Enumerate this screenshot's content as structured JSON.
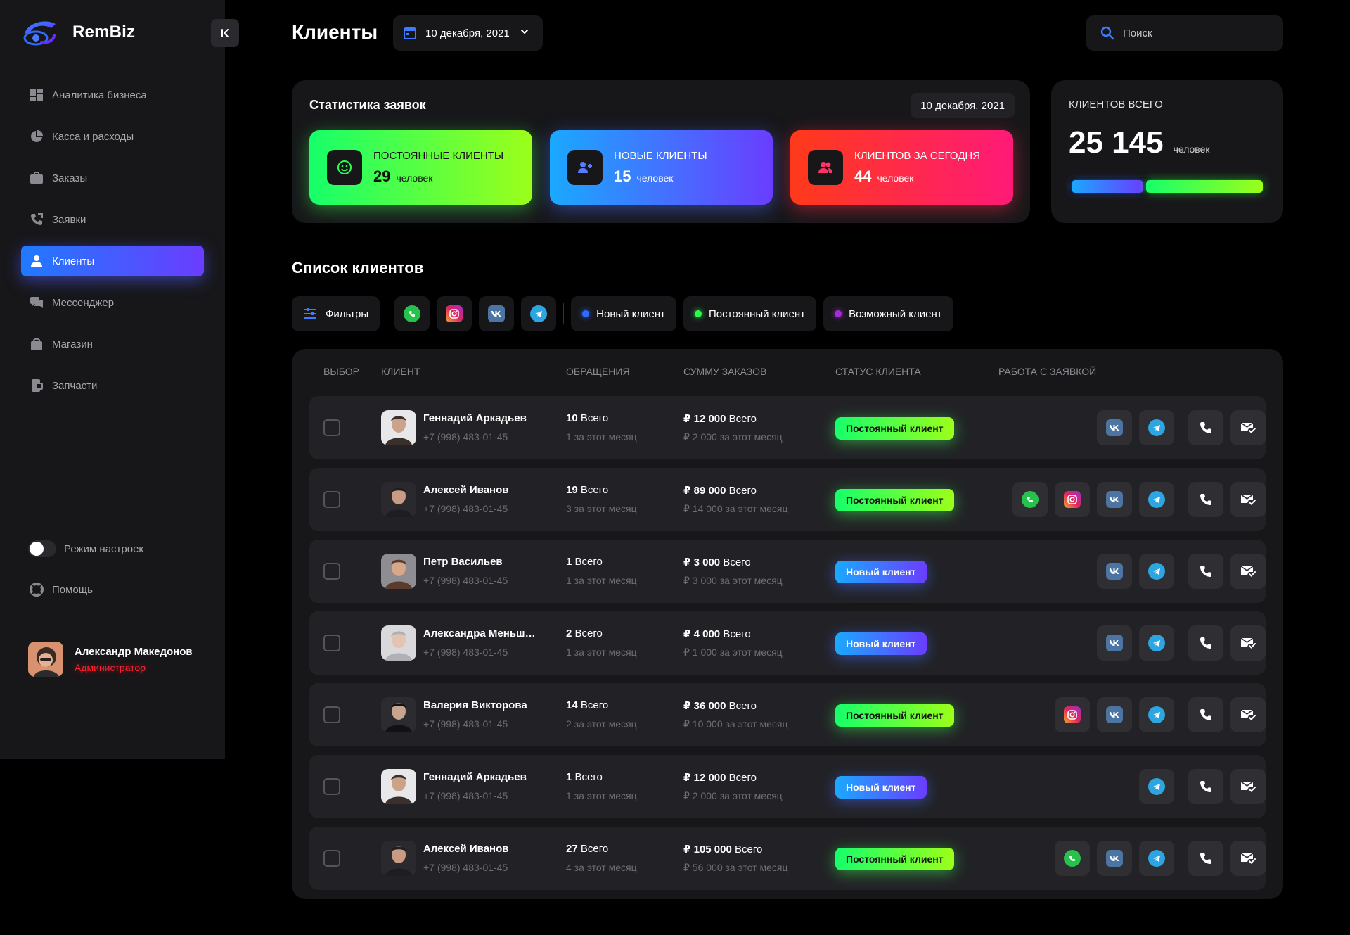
{
  "app": {
    "name": "RemBiz"
  },
  "sidebar": {
    "items": [
      {
        "label": "Аналитика бизнеса",
        "icon": "dashboard-icon"
      },
      {
        "label": "Касса и расходы",
        "icon": "pie-chart-icon"
      },
      {
        "label": "Заказы",
        "icon": "briefcase-icon"
      },
      {
        "label": "Заявки",
        "icon": "phone-call-icon"
      },
      {
        "label": "Клиенты",
        "icon": "user-icon",
        "active": true
      },
      {
        "label": "Мессенджер",
        "icon": "chat-icon"
      },
      {
        "label": "Магазин",
        "icon": "shopping-bag-icon"
      },
      {
        "label": "Запчасти",
        "icon": "parts-icon"
      }
    ],
    "settings_label": "Режим настроек",
    "help_label": "Помощь",
    "user": {
      "name": "Александр Македонов",
      "role": "Администратор"
    }
  },
  "header": {
    "title": "Клиенты",
    "date": "10 декабря, 2021",
    "search_placeholder": "Поиск"
  },
  "stats": {
    "title": "Статистика заявок",
    "date": "10 декабря, 2021",
    "cards": [
      {
        "label": "ПОСТОЯННЫЕ КЛИЕНТЫ",
        "value": "29",
        "unit": "человек",
        "icon": "smile-icon"
      },
      {
        "label": "НОВЫЕ КЛИЕНТЫ",
        "value": "15",
        "unit": "человек",
        "icon": "add-user-icon"
      },
      {
        "label": "КЛИЕНТОВ ЗА СЕГОДНЯ",
        "value": "44",
        "unit": "человек",
        "icon": "users-icon"
      }
    ]
  },
  "total": {
    "label": "КЛИЕНТОВ ВСЕГО",
    "value": "25 145",
    "unit": "человек",
    "bar_new_fraction": 0.38,
    "bar_regular_fraction": 0.62
  },
  "list": {
    "title": "Список клиентов",
    "filters_label": "Фильтры",
    "legend": [
      {
        "label": "Новый клиент",
        "color": "#2f6bff"
      },
      {
        "label": "Постоянный клиент",
        "color": "#29ff4a"
      },
      {
        "label": "Возможный клиент",
        "color": "#a62bd9"
      }
    ],
    "columns": [
      "ВЫБОР",
      "КЛИЕНТ",
      "ОБРАЩЕНИЯ",
      "СУММУ ЗАКАЗОВ",
      "СТАТУС КЛИЕНТА",
      "РАБОТА С ЗАЯВКОЙ"
    ],
    "rows": [
      {
        "name": "Геннадий Аркадьев",
        "phone": "+7 (998) 483-01-45",
        "req_total": "10",
        "req_total_suffix": "Всего",
        "req_month": "1 за этот месяц",
        "sum_total": "₽ 12 000",
        "sum_total_suffix": "Всего",
        "sum_month": "₽ 2 000 за этот месяц",
        "status": "Постоянный клиент",
        "status_type": "perm",
        "channels": [
          "vk",
          "telegram"
        ]
      },
      {
        "name": "Алексей Иванов",
        "phone": "+7 (998) 483-01-45",
        "req_total": "19",
        "req_total_suffix": "Всего",
        "req_month": "3 за этот месяц",
        "sum_total": "₽ 89 000",
        "sum_total_suffix": "Всего",
        "sum_month": "₽ 14 000 за этот месяц",
        "status": "Постоянный клиент",
        "status_type": "perm",
        "channels": [
          "whatsapp",
          "instagram",
          "vk",
          "telegram"
        ]
      },
      {
        "name": "Петр Васильев",
        "phone": "+7 (998) 483-01-45",
        "req_total": "1",
        "req_total_suffix": "Всего",
        "req_month": "1 за этот месяц",
        "sum_total": "₽ 3 000",
        "sum_total_suffix": "Всего",
        "sum_month": "₽ 3 000 за этот месяц",
        "status": "Новый клиент",
        "status_type": "new",
        "channels": [
          "vk",
          "telegram"
        ]
      },
      {
        "name": "Александра Меньшикова",
        "phone": "+7 (998) 483-01-45",
        "req_total": "2",
        "req_total_suffix": "Всего",
        "req_month": "1 за этот месяц",
        "sum_total": "₽ 4 000",
        "sum_total_suffix": "Всего",
        "sum_month": "₽ 1 000 за этот месяц",
        "status": "Новый клиент",
        "status_type": "new",
        "channels": [
          "vk",
          "telegram"
        ]
      },
      {
        "name": "Валерия Викторова",
        "phone": "+7 (998) 483-01-45",
        "req_total": "14",
        "req_total_suffix": "Всего",
        "req_month": "2 за этот месяц",
        "sum_total": "₽ 36 000",
        "sum_total_suffix": "Всего",
        "sum_month": "₽ 10 000 за этот месяц",
        "status": "Постоянный клиент",
        "status_type": "perm",
        "channels": [
          "instagram",
          "vk",
          "telegram"
        ]
      },
      {
        "name": "Геннадий Аркадьев",
        "phone": "+7 (998) 483-01-45",
        "req_total": "1",
        "req_total_suffix": "Всего",
        "req_month": "1 за этот месяц",
        "sum_total": "₽ 12 000",
        "sum_total_suffix": "Всего",
        "sum_month": "₽ 2 000 за этот месяц",
        "status": "Новый клиент",
        "status_type": "new",
        "channels": [
          "telegram"
        ]
      },
      {
        "name": "Алексей Иванов",
        "phone": "+7 (998) 483-01-45",
        "req_total": "27",
        "req_total_suffix": "Всего",
        "req_month": "4 за этот месяц",
        "sum_total": "₽ 105 000",
        "sum_total_suffix": "Всего",
        "sum_month": "₽ 56 000 за этот месяц",
        "status": "Постоянный клиент",
        "status_type": "perm",
        "channels": [
          "whatsapp",
          "vk",
          "telegram"
        ]
      }
    ]
  }
}
